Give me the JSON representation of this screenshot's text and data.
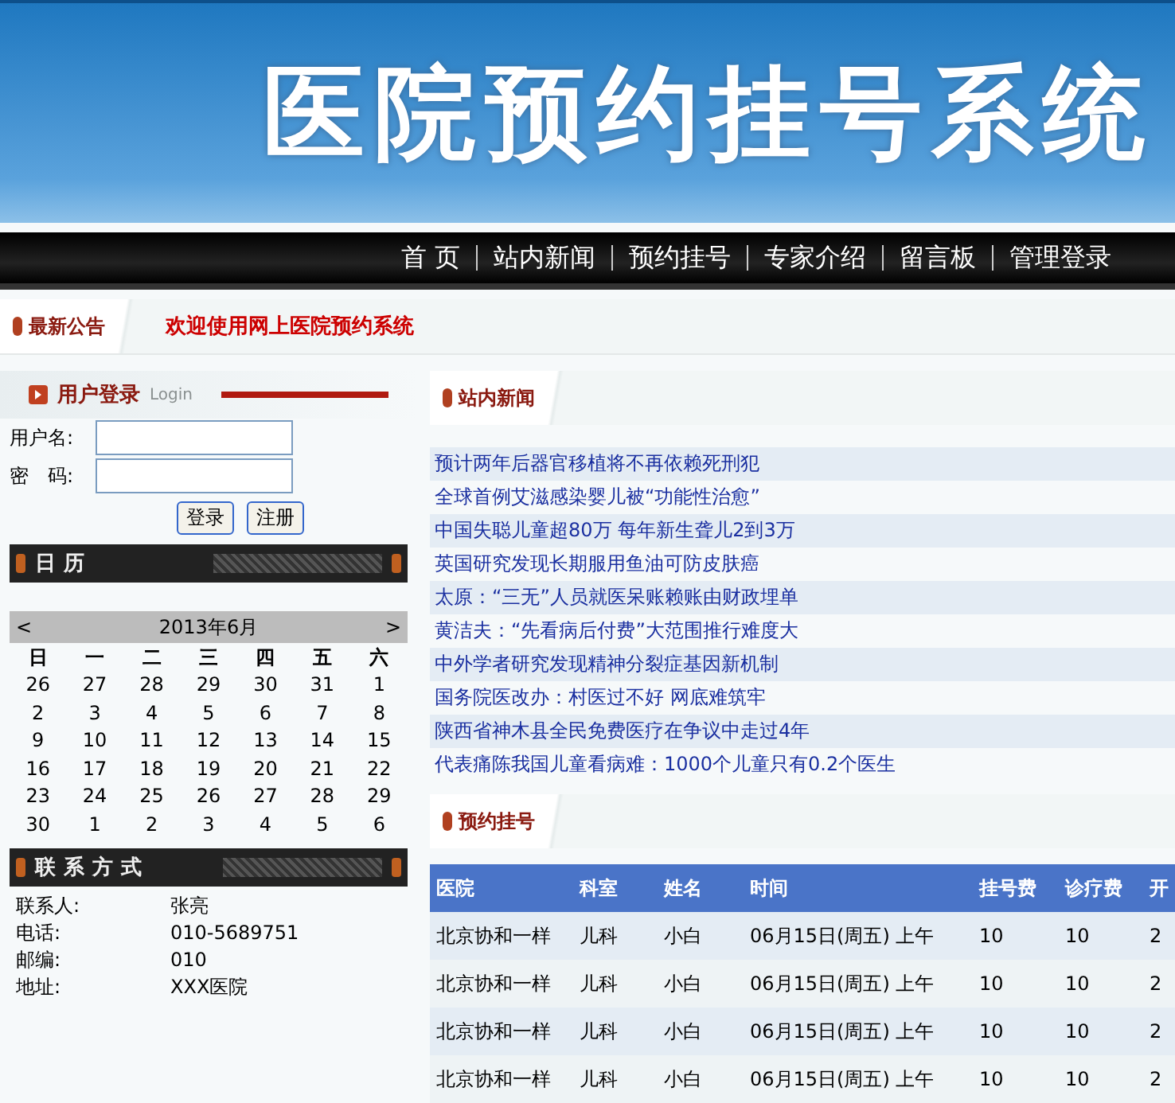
{
  "banner": {
    "title": "医院预约挂号系统"
  },
  "nav": [
    "首 页",
    "站内新闻",
    "预约挂号",
    "专家介绍",
    "留言板",
    "管理登录"
  ],
  "notice": {
    "heading": "最新公告",
    "text": "欢迎使用网上医院预约系统"
  },
  "login": {
    "heading": "用户登录",
    "subheading": "Login",
    "fields": [
      {
        "label": "用户名:"
      },
      {
        "label": "密　码:"
      }
    ],
    "buttons": [
      "登录",
      "注册"
    ]
  },
  "calendar": {
    "heading": "日历",
    "prev": "<",
    "month": "2013年6月",
    "next": ">",
    "weekdays": [
      "日",
      "一",
      "二",
      "三",
      "四",
      "五",
      "六"
    ],
    "weeks": [
      [
        "26",
        "27",
        "28",
        "29",
        "30",
        "31",
        "1"
      ],
      [
        "2",
        "3",
        "4",
        "5",
        "6",
        "7",
        "8"
      ],
      [
        "9",
        "10",
        "11",
        "12",
        "13",
        "14",
        "15"
      ],
      [
        "16",
        "17",
        "18",
        "19",
        "20",
        "21",
        "22"
      ],
      [
        "23",
        "24",
        "25",
        "26",
        "27",
        "28",
        "29"
      ],
      [
        "30",
        "1",
        "2",
        "3",
        "4",
        "5",
        "6"
      ]
    ]
  },
  "contact": {
    "heading": "联系方式",
    "rows": [
      {
        "label": "联系人:",
        "value": "张亮"
      },
      {
        "label": "电话:",
        "value": "010-5689751"
      },
      {
        "label": "邮编:",
        "value": "010"
      },
      {
        "label": "地址:",
        "value": "XXX医院"
      }
    ]
  },
  "news": {
    "heading": "站内新闻",
    "items": [
      "预计两年后器官移植将不再依赖死刑犯",
      "全球首例艾滋感染婴儿被“功能性治愈”",
      "中国失聪儿童超80万 每年新生聋儿2到3万",
      "英国研究发现长期服用鱼油可防皮肤癌",
      "太原：“三无”人员就医呆账赖账由财政埋单",
      "黄洁夫：“先看病后付费”大范围推行难度大",
      "中外学者研究发现精神分裂症基因新机制",
      "国务院医改办：村医过不好 网底难筑牢",
      "陕西省神木县全民免费医疗在争议中走过4年",
      "代表痛陈我国儿童看病难：1000个儿童只有0.2个医生"
    ]
  },
  "appointments": {
    "heading": "预约挂号",
    "columns": [
      "医院",
      "科室",
      "姓名",
      "时间",
      "挂号费",
      "诊疗费",
      "开"
    ],
    "rows": [
      [
        "北京协和一样",
        "儿科",
        "小白",
        "06月15日(周五) 上午",
        "10",
        "10",
        "2"
      ],
      [
        "北京协和一样",
        "儿科",
        "小白",
        "06月15日(周五) 上午",
        "10",
        "10",
        "2"
      ],
      [
        "北京协和一样",
        "儿科",
        "小白",
        "06月15日(周五) 上午",
        "10",
        "10",
        "2"
      ],
      [
        "北京协和一样",
        "儿科",
        "小白",
        "06月15日(周五) 上午",
        "10",
        "10",
        "2"
      ]
    ]
  }
}
